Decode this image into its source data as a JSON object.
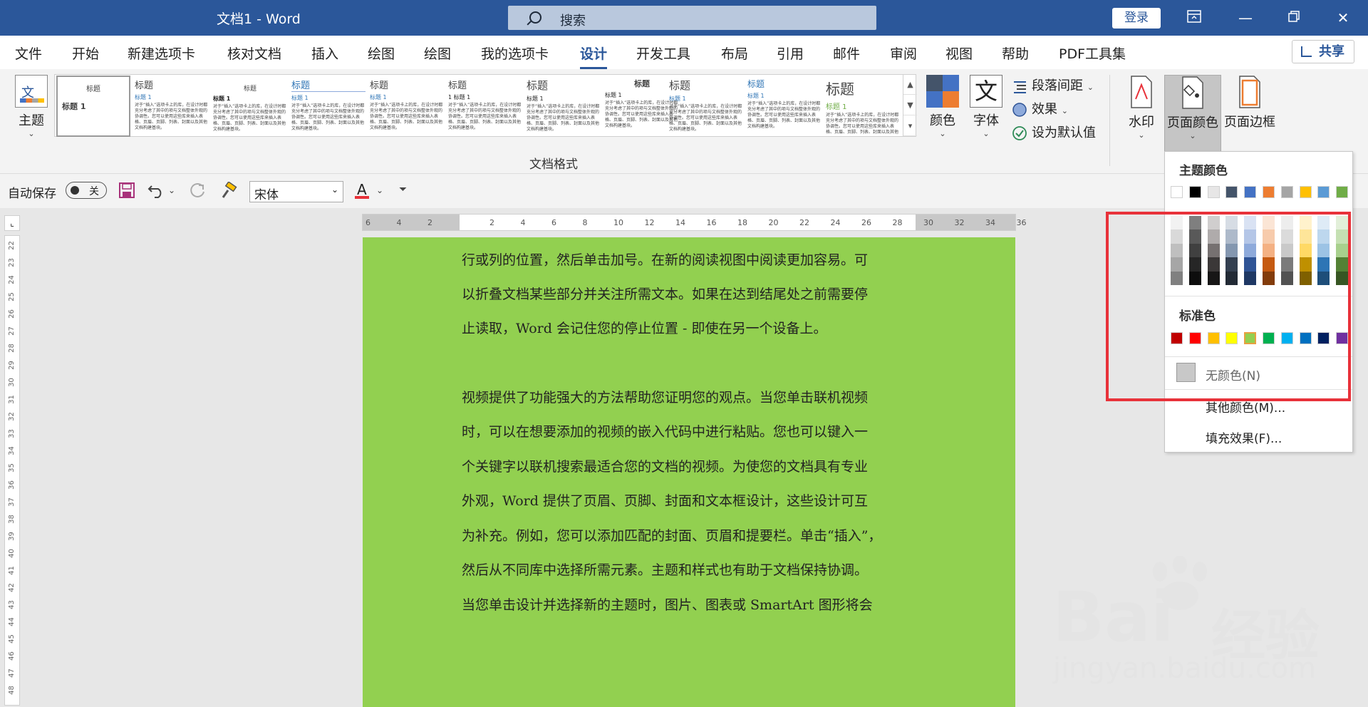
{
  "titlebar": {
    "doc_title": "文档1 - Word",
    "search_placeholder": "搜索",
    "login": "登录"
  },
  "tabs": [
    {
      "label": "文件"
    },
    {
      "label": "开始"
    },
    {
      "label": "新建选项卡"
    },
    {
      "label": "核对文档"
    },
    {
      "label": "插入"
    },
    {
      "label": "绘图"
    },
    {
      "label": "绘图"
    },
    {
      "label": "我的选项卡"
    },
    {
      "label": "设计"
    },
    {
      "label": "开发工具"
    },
    {
      "label": "布局"
    },
    {
      "label": "引用"
    },
    {
      "label": "邮件"
    },
    {
      "label": "审阅"
    },
    {
      "label": "视图"
    },
    {
      "label": "帮助"
    },
    {
      "label": "PDF工具集"
    }
  ],
  "active_tab": "设计",
  "share": "共享",
  "ribbon": {
    "theme": "主题",
    "gallery_items": [
      {
        "h": "标题",
        "sub": "标题 1"
      },
      {
        "h": "标题",
        "sub": "标题 1"
      },
      {
        "h": "标题",
        "sub": "标题 1"
      },
      {
        "h": "标题",
        "sub": "标题 1"
      },
      {
        "h": "标题",
        "sub": "标题 1"
      },
      {
        "h": "标题",
        "sub": "1 标题 1"
      },
      {
        "h": "标题",
        "sub": "标题 1"
      },
      {
        "h": "标题",
        "sub": "标题 1"
      },
      {
        "h": "标题",
        "sub": "标题 1"
      },
      {
        "h": "标题",
        "sub": "标题 1"
      },
      {
        "h": "标题",
        "sub": "标题 1"
      }
    ],
    "sample_text": "对于“插入”选项卡上的库，在设计时都充分考虑了其中的项与文档整体外观的协调性。您可以使用这些库来插入表格、页眉、页脚、列表、封面以及其他文档构建基块。",
    "group_label": "文档格式",
    "colors": "颜色",
    "fonts": "字体",
    "fonts_glyph": "文",
    "paragraph_spacing": "段落间距",
    "effects": "效果",
    "set_default": "设为默认值",
    "watermark": "水印",
    "page_color": "页面颜色",
    "page_border": "页面边框",
    "theme_glyph": "文"
  },
  "qat": {
    "autosave": "自动保存",
    "toggle": "关",
    "font": "宋体",
    "font_color_glyph": "A"
  },
  "ruler": {
    "h_numbers": [
      "6",
      "4",
      "2",
      "",
      "2",
      "4",
      "6",
      "8",
      "10",
      "12",
      "14",
      "16",
      "18",
      "20",
      "22",
      "24",
      "26",
      "28",
      "30",
      "32",
      "34",
      "36"
    ],
    "v_numbers": [
      "22",
      "23",
      "24",
      "25",
      "26",
      "27",
      "28",
      "29",
      "30",
      "31",
      "32",
      "33",
      "34",
      "35",
      "36",
      "37",
      "38",
      "39",
      "40",
      "41",
      "42",
      "43",
      "44",
      "45",
      "46",
      "47",
      "48"
    ]
  },
  "document": {
    "lines": [
      "行或列的位置，然后单击加号。在新的阅读视图中阅读更加容易。可",
      "以折叠文档某些部分并关注所需文本。如果在达到结尾处之前需要停",
      "止读取，Word 会记住您的停止位置 - 即使在另一个设备上。",
      "",
      "视频提供了功能强大的方法帮助您证明您的观点。当您单击联机视频",
      "时，可以在想要添加的视频的嵌入代码中进行粘贴。您也可以键入一",
      "个关键字以联机搜索最适合您的文档的视频。为使您的文档具有专业",
      "外观，Word 提供了页眉、页脚、封面和文本框设计，这些设计可互",
      "为补充。例如，您可以添加匹配的封面、页眉和提要栏。单击“插入”，",
      "然后从不同库中选择所需元素。主题和样式也有助于文档保持协调。",
      "当您单击设计并选择新的主题时，图片、图表或 SmartArt 图形将会"
    ],
    "page_color": "#92d050"
  },
  "dropdown": {
    "theme_colors_title": "主题颜色",
    "standard_colors_title": "标准色",
    "no_color": "无颜色(N)",
    "more_colors": "其他颜色(M)...",
    "fill_effects": "填充效果(F)...",
    "theme_colors": [
      "#ffffff",
      "#000000",
      "#e7e6e6",
      "#44546a",
      "#4472c4",
      "#ed7d31",
      "#a5a5a5",
      "#ffc000",
      "#5b9bd5",
      "#70ad47"
    ],
    "theme_shades": [
      [
        "#f2f2f2",
        "#d9d9d9",
        "#bfbfbf",
        "#a6a6a6",
        "#808080"
      ],
      [
        "#7f7f7f",
        "#595959",
        "#404040",
        "#262626",
        "#0d0d0d"
      ],
      [
        "#d0cece",
        "#afabab",
        "#767171",
        "#3b3838",
        "#171616"
      ],
      [
        "#d6dce4",
        "#adb9ca",
        "#8497b0",
        "#333f50",
        "#222a35"
      ],
      [
        "#d9e2f3",
        "#b4c6e7",
        "#8eaadb",
        "#2f5496",
        "#1f3864"
      ],
      [
        "#fbe5d5",
        "#f7cbac",
        "#f4b183",
        "#c55a11",
        "#833c0b"
      ],
      [
        "#ededed",
        "#dbdbdb",
        "#c9c9c9",
        "#7b7b7b",
        "#525252"
      ],
      [
        "#fff2cc",
        "#fee599",
        "#ffd965",
        "#bf9000",
        "#7f6000"
      ],
      [
        "#deebf6",
        "#bdd7ee",
        "#9cc3e5",
        "#2e75b5",
        "#1e4e79"
      ],
      [
        "#e2efd9",
        "#c5e0b3",
        "#a8d08d",
        "#538135",
        "#375623"
      ]
    ],
    "standard_colors": [
      "#c00000",
      "#ff0000",
      "#ffc000",
      "#ffff00",
      "#92d050",
      "#00b050",
      "#00b0f0",
      "#0070c0",
      "#002060",
      "#7030a0"
    ],
    "selected_standard": "#92d050"
  },
  "watermark": {
    "brand": "Bai",
    "brand2": "经验",
    "url": "jingyan.baidu.com"
  }
}
